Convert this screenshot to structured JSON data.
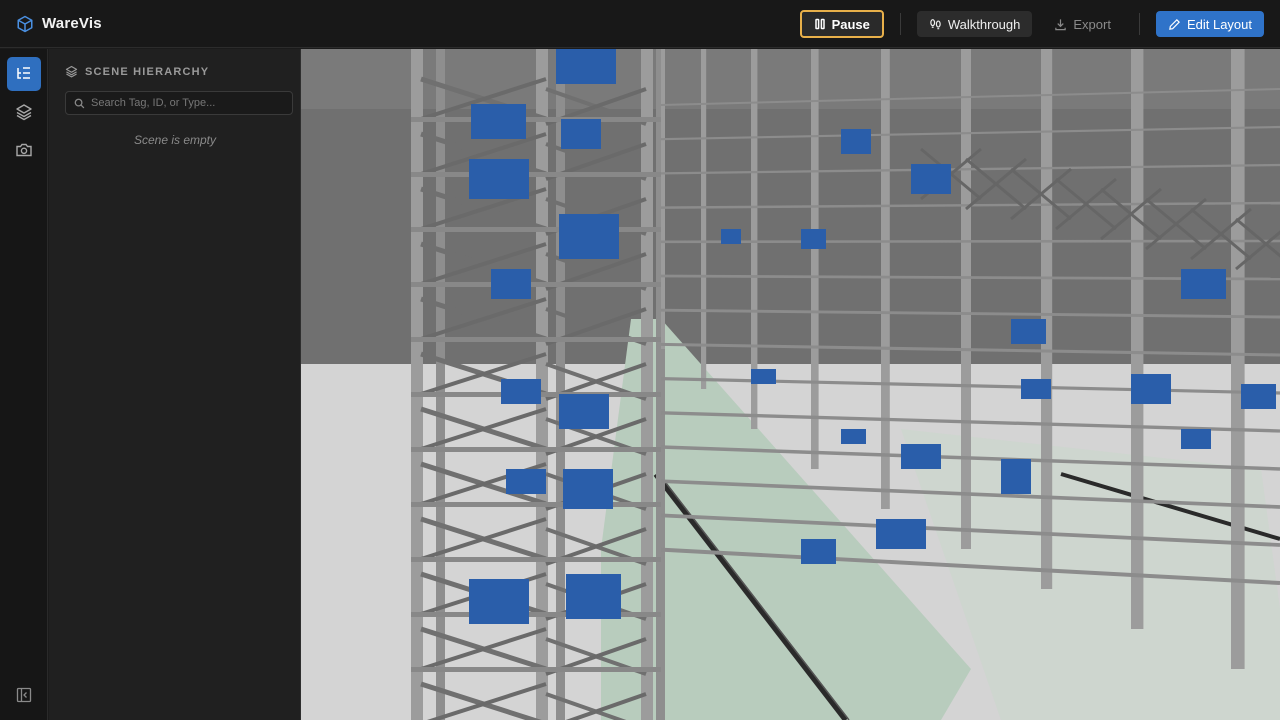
{
  "app": {
    "name": "WareVis"
  },
  "toolbar": {
    "pause_label": "Pause",
    "walkthrough_label": "Walkthrough",
    "export_label": "Export",
    "edit_layout_label": "Edit Layout"
  },
  "sidebar": {
    "title": "SCENE HIERARCHY",
    "search_placeholder": "Search Tag, ID, or Type...",
    "empty_text": "Scene is empty"
  },
  "rail": {
    "items": [
      {
        "icon": "hierarchy-icon",
        "active": true
      },
      {
        "icon": "layers-icon",
        "active": false
      },
      {
        "icon": "camera-icon",
        "active": false
      }
    ]
  },
  "colors": {
    "accent": "#2f73c9",
    "pause_border": "#e8b04a",
    "rack": "#9c9c9c",
    "box": "#2a5eaa",
    "floor": "#d6d6d6",
    "aisle": "#b6c9bb"
  }
}
